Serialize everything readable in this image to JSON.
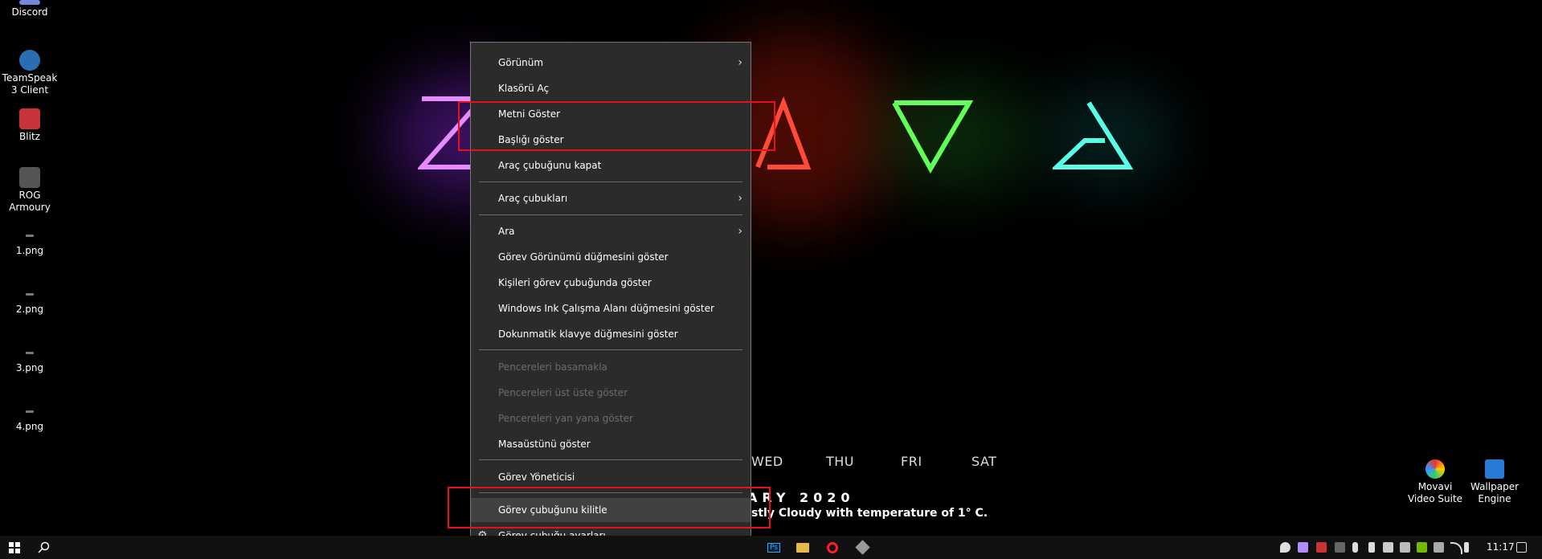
{
  "desktop_icons": [
    {
      "label": "Discord",
      "icon": "discord-icon"
    },
    {
      "label": "TeamSpeak 3 Client",
      "icon": "teamspeak-icon"
    },
    {
      "label": "Blitz",
      "icon": "blitz-icon"
    },
    {
      "label": "ROG Armoury",
      "icon": "rog-icon"
    },
    {
      "label": "1.png",
      "icon": "image-file-icon"
    },
    {
      "label": "2.png",
      "icon": "image-file-icon"
    },
    {
      "label": "3.png",
      "icon": "image-file-icon"
    },
    {
      "label": "4.png",
      "icon": "image-file-icon"
    }
  ],
  "right_icons": [
    {
      "label": "Movavi Video Suite",
      "icon": "movavi-icon"
    },
    {
      "label": "Wallpaper Engine",
      "icon": "wallpaper-engine-icon"
    }
  ],
  "calendar": {
    "days": [
      "WED",
      "THU",
      "FRI",
      "SAT"
    ],
    "month_fragment": "ARY 2020",
    "weather_fragment": "stly Cloudy with temperature of 1° C."
  },
  "menu": {
    "items": [
      {
        "label": "Görünüm",
        "submenu": true
      },
      {
        "label": "Klasörü Aç"
      },
      {
        "label": "Metni Göster"
      },
      {
        "label": "Başlığı göster"
      },
      {
        "label": "Araç çubuğunu kapat"
      },
      {
        "label": "Araç çubukları",
        "submenu": true
      },
      {
        "label": "Ara",
        "submenu": true
      },
      {
        "label": "Görev Görünümü düğmesini göster"
      },
      {
        "label": "Kişileri görev çubuğunda göster"
      },
      {
        "label": "Windows Ink Çalışma Alanı düğmesini göster"
      },
      {
        "label": "Dokunmatik klavye düğmesini göster"
      },
      {
        "label": "Pencereleri basamakla",
        "disabled": true
      },
      {
        "label": "Pencereleri üst üste göster",
        "disabled": true
      },
      {
        "label": "Pencereleri yan yana göster",
        "disabled": true
      },
      {
        "label": "Masaüstünü göster"
      },
      {
        "label": "Görev Yöneticisi"
      },
      {
        "label": "Görev çubuğunu kilitle"
      },
      {
        "label": "Görev çubuğu ayarları"
      }
    ],
    "arrow_glyph": "›",
    "gear_glyph": "⚙"
  },
  "taskbar": {
    "start_icon": "windows-start-icon",
    "search_icon": "search-icon",
    "ps_label": "Ps",
    "clock": "11:17"
  },
  "colors": {
    "highlight_box": "#e8101a",
    "menu_bg": "#2b2b2b",
    "taskbar_bg": "#111111"
  }
}
